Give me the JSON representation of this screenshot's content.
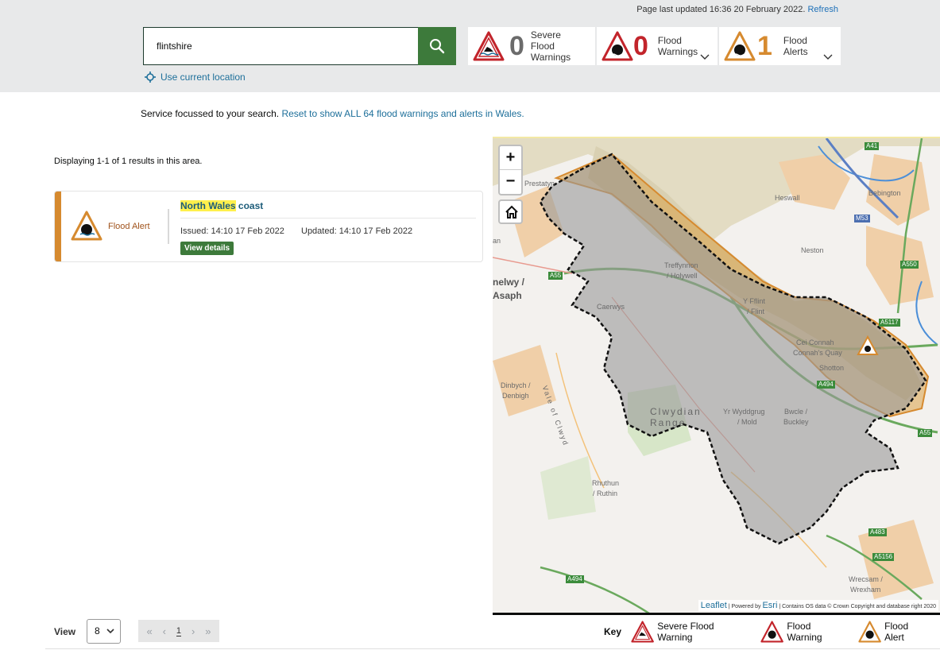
{
  "header": {
    "updated_text": "Page last updated 16:36 20 February 2022.",
    "refresh_label": "Refresh"
  },
  "search": {
    "value": "flintshire",
    "button_icon": "search-icon",
    "use_location_label": "Use current location"
  },
  "summary": {
    "severe": {
      "count": "0",
      "label_1": "Severe",
      "label_2": "Flood",
      "label_3": "Warnings"
    },
    "warnings": {
      "count": "0",
      "label_1": "Flood",
      "label_2": "Warnings"
    },
    "alerts": {
      "count": "1",
      "label_1": "Flood",
      "label_2": "Alerts"
    }
  },
  "focus": {
    "text": "Service focussed to your search.",
    "link": "Reset to show ALL 64 flood warnings and alerts in Wales."
  },
  "results": {
    "displaying": "Displaying 1-1 of 1 results in this area.",
    "items": [
      {
        "type": "Flood Alert",
        "area_highlight": "North Wales",
        "area_rest": " coast",
        "issued": "Issued: 14:10 17 Feb 2022",
        "updated": "Updated: 14:10 17 Feb 2022",
        "details_label": "View details"
      }
    ]
  },
  "pagination": {
    "view_label": "View",
    "page_size": "8",
    "first": "«",
    "prev": "‹",
    "page": "1",
    "next": "›",
    "last": "»"
  },
  "map": {
    "zoom_in": "+",
    "zoom_out": "−",
    "labels": {
      "heswall": "Heswall",
      "bebington": "Bebington",
      "neston": "Neston",
      "treffynnon": "Treffynnon",
      "holywell": "/ Holywell",
      "caerwys": "Caerwys",
      "fflint": "Y Fflint",
      "flint": "/ Flint",
      "cei_connah": "Cei Connah",
      "connahs_quay": "Connah's Quay",
      "shotton": "Shotton",
      "denbigh_1": "Dinbych /",
      "denbigh_2": "Denbigh",
      "clwydian_1": "Clwydian",
      "clwydian_2": "Range",
      "mold_1": "Yr Wyddgrug",
      "mold_2": "/ Mold",
      "buckley_1": "Bwcle /",
      "buckley_2": "Buckley",
      "ruthin_1": "Rhuthun",
      "ruthin_2": "/ Ruthin",
      "wrexham_1": "Wrecsam /",
      "wrexham_2": "Wrexham",
      "st_asaph_1": "nelwy /",
      "st_asaph_2": "Asaph",
      "vale": "Vale of Clwyd",
      "prestatyn": "Prestatyn",
      "an": "an"
    },
    "roads": {
      "a41": "A41",
      "m53": "M53",
      "a550": "A550",
      "a55_west": "A55",
      "a5117": "A5117",
      "a494": "A494",
      "a55_east": "A55",
      "a483": "A483",
      "a5156": "A5156",
      "a494_south": "A494"
    },
    "attribution": {
      "leaflet": "Leaflet",
      "powered": "| Powered by",
      "esri": "Esri",
      "rest": "| Contains OS data © Crown Copyright and database right 2020"
    }
  },
  "key": {
    "title": "Key",
    "severe": "Severe Flood Warning",
    "warning": "Flood Warning",
    "alert": "Flood Alert"
  },
  "colors": {
    "alert_orange": "#d68a2f",
    "warning_red": "#c2242b",
    "primary_green": "#3d7a3b",
    "link_blue": "#1d6f9a"
  }
}
